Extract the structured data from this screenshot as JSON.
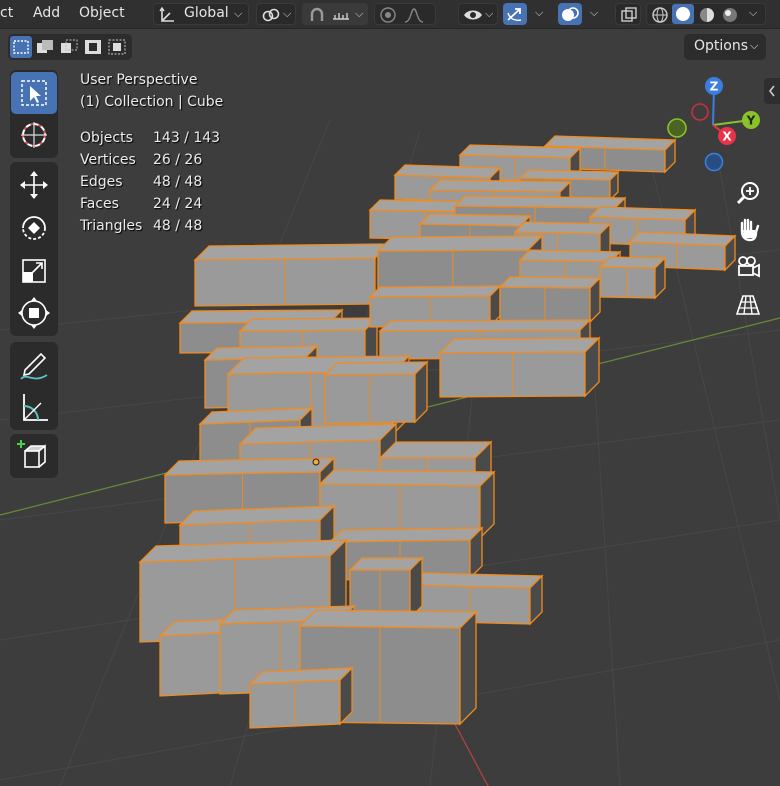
{
  "header": {
    "menus": [
      "ct",
      "Add",
      "Object"
    ],
    "orientation": "Global",
    "icons": [
      "transform-orientation-icon",
      "pivot-icon",
      "snap-icon",
      "snap-increment-icon",
      "proportional-editing-icon",
      "falloff-icon",
      "visibility-icon",
      "gizmo-icon",
      "overlay-icon",
      "xray-icon",
      "wireframe-shading-icon",
      "solid-shading-icon",
      "material-shading-icon",
      "rendered-shading-icon"
    ]
  },
  "select_modes": [
    "select-new-icon",
    "select-extend-icon",
    "select-subtract-icon",
    "select-invert-icon",
    "select-intersect-icon"
  ],
  "options_label": "Options",
  "toolbar": [
    "select-box-icon",
    "cursor-icon",
    "move-icon",
    "rotate-icon",
    "scale-icon",
    "transform-icon",
    "annotate-icon",
    "measure-icon",
    "add-cube-icon"
  ],
  "stats": {
    "view": "User Perspective",
    "collection": "(1) Collection | Cube",
    "rows": [
      {
        "label": "Objects",
        "value": "143 / 143"
      },
      {
        "label": "Vertices",
        "value": "26 / 26"
      },
      {
        "label": "Edges",
        "value": "48 / 48"
      },
      {
        "label": "Faces",
        "value": "24 / 24"
      },
      {
        "label": "Triangles",
        "value": "48 / 48"
      }
    ]
  },
  "gizmo": {
    "z": "Z",
    "y": "Y",
    "x": "X"
  },
  "nav": [
    "zoom-icon",
    "pan-hand-icon",
    "camera-icon",
    "perspective-grid-icon"
  ],
  "colors": {
    "accent": "#4772b3",
    "selection": "#f28b1d",
    "viewport": "#3d3d3d",
    "x_axis": "#e8334a",
    "y_axis": "#8bc22a",
    "z_axis": "#3b7ee0"
  }
}
